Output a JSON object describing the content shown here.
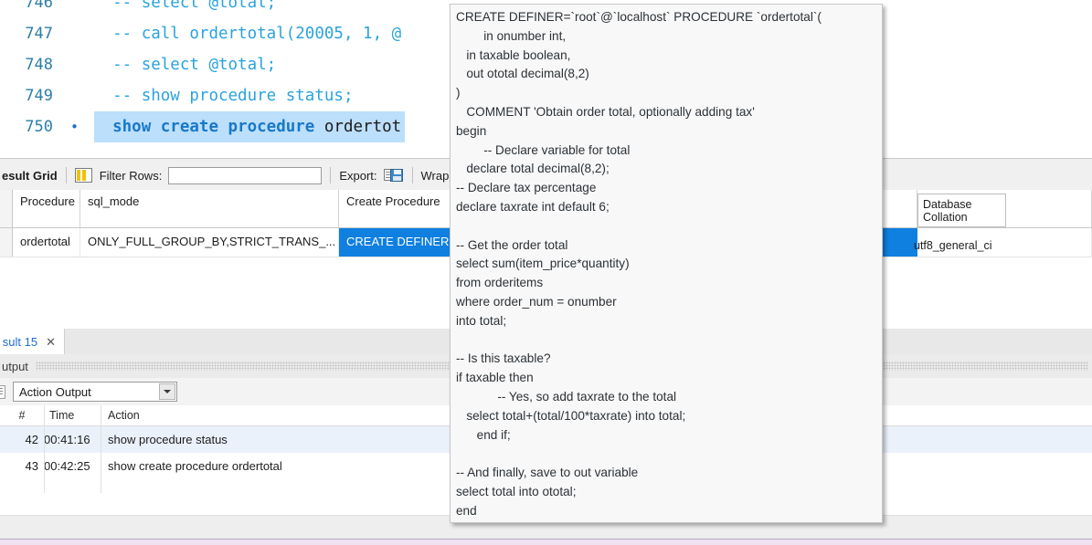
{
  "editor": {
    "lines": [
      {
        "number": "746",
        "marker": "",
        "text": "-- select @total;",
        "style": "comment",
        "highlighted": false
      },
      {
        "number": "747",
        "marker": "",
        "text": "-- call ordertotal(20005, 1, @",
        "style": "comment",
        "highlighted": false
      },
      {
        "number": "748",
        "marker": "",
        "text": "-- select @total;",
        "style": "comment",
        "highlighted": false
      },
      {
        "number": "749",
        "marker": "",
        "text": "-- show procedure status;",
        "style": "comment",
        "highlighted": false
      },
      {
        "number": "750",
        "marker": "•",
        "text": "show create procedure ordertot",
        "keyword_part": "show create procedure ",
        "ident_part": "ordertot",
        "style": "statement",
        "highlighted": true
      }
    ]
  },
  "result_toolbar": {
    "title": "esult Grid",
    "grid_icon": "grid-icon",
    "filter_label": "Filter Rows:",
    "filter_value": "",
    "filter_placeholder": "",
    "export_label": "Export:",
    "export_icon": "export-save-icon",
    "wrap_label": "Wrap Cell Conte"
  },
  "result_grid": {
    "columns": [
      "Procedure",
      "sql_mode",
      "Create Procedure"
    ],
    "rows": [
      {
        "procedure": "ordertotal",
        "sql_mode": "ONLY_FULL_GROUP_BY,STRICT_TRANS_...",
        "create_procedure": "CREATE DEFINER=`",
        "selected_cell": "create_procedure"
      }
    ],
    "collation_header": "Database\nCollation",
    "collation_header_line1": "Database",
    "collation_header_line2": "Collation",
    "collation_value": "utf8_general_ci",
    "selection_color": "#0f7fe0"
  },
  "result_tab": {
    "label": "sult 15",
    "close_icon": "close-icon"
  },
  "output_panel": {
    "title": "utput",
    "filter_icon": "list-icon",
    "selected_view": "Action Output",
    "view_options": [
      "Action Output"
    ],
    "columns": [
      "#",
      "Time",
      "Action"
    ],
    "rows": [
      {
        "num": "42",
        "time": "00:41:16",
        "action": "show procedure status"
      },
      {
        "num": "43",
        "time": "00:42:25",
        "action": "show create procedure ordertotal"
      }
    ]
  },
  "tooltip": {
    "lines": [
      "CREATE DEFINER=`root`@`localhost` PROCEDURE `ordertotal`(",
      "        in onumber int,",
      "   in taxable boolean,",
      "   out ototal decimal(8,2)",
      ")",
      "   COMMENT 'Obtain order total, optionally adding tax'",
      "begin",
      "        -- Declare variable for total",
      "   declare total decimal(8,2);",
      "-- Declare tax percentage",
      "declare taxrate int default 6;",
      "",
      "-- Get the order total",
      "select sum(item_price*quantity)",
      "from orderitems",
      "where order_num = onumber",
      "into total;",
      "",
      "-- Is this taxable?",
      "if taxable then",
      "            -- Yes, so add taxrate to the total",
      "   select total+(total/100*taxrate) into total;",
      "      end if;",
      "",
      "-- And finally, save to out variable",
      "select total into ototal;",
      "end"
    ]
  }
}
